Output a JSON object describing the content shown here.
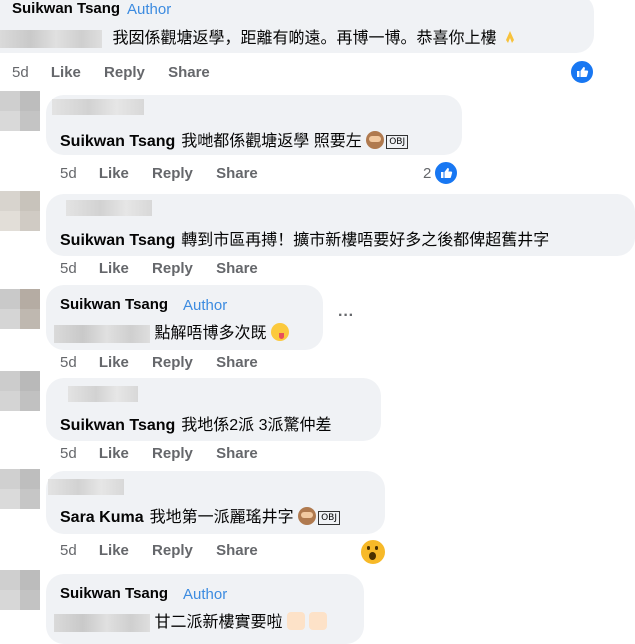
{
  "comments": [
    {
      "id": "c1",
      "name": "Suikwan Tsang",
      "author_label": "Author",
      "text": "我囡係觀塘返學，距離有啲遠。再博一博。恭喜你上樓",
      "emoji": "folded-hands",
      "time": "5d",
      "actions": [
        "Like",
        "Reply",
        "Share"
      ],
      "reaction": "like"
    },
    {
      "id": "c2",
      "mention": "Suikwan Tsang",
      "text": "我哋都係觀塘返學 照要左",
      "emoji": "see-no-evil-monkey",
      "obj": "OBJ",
      "time": "5d",
      "actions": [
        "Like",
        "Reply",
        "Share"
      ],
      "reaction": "like",
      "reaction_count": "2"
    },
    {
      "id": "c3",
      "mention": "Suikwan Tsang",
      "text": "轉到市區再搏！擴市新樓唔要好多之後都俾超舊井字",
      "time": "5d",
      "actions": [
        "Like",
        "Reply",
        "Share"
      ]
    },
    {
      "id": "c4",
      "name": "Suikwan Tsang",
      "author_label": "Author",
      "text": "點解唔博多次既",
      "emoji": "zany-face",
      "time": "5d",
      "actions": [
        "Like",
        "Reply",
        "Share"
      ],
      "more": "···"
    },
    {
      "id": "c5",
      "mention": "Suikwan Tsang",
      "text": "我地係2派 3派驚仲差",
      "time": "5d",
      "actions": [
        "Like",
        "Reply",
        "Share"
      ]
    },
    {
      "id": "c6",
      "mention": "Sara Kuma",
      "text": "我地第一派麗瑤井字",
      "emoji": "see-no-evil-monkey",
      "obj": "OBJ",
      "time": "5d",
      "actions": [
        "Like",
        "Reply",
        "Share"
      ],
      "reaction": "wow"
    },
    {
      "id": "c7",
      "name": "Suikwan Tsang",
      "author_label": "Author",
      "text": "甘二派新樓實要啦",
      "emoji": "heart-hands",
      "emoji_count": 2
    }
  ],
  "colors": {
    "bubble": "#f0f2f5",
    "author": "#3c8be0",
    "meta": "#65676b",
    "like_blue": "#1877f2"
  }
}
